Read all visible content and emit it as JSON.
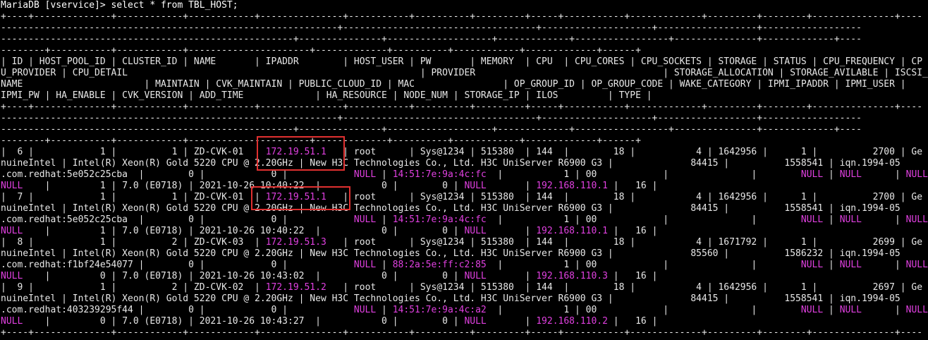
{
  "terminal": {
    "lines": [
      {
        "segs": [
          {
            "t": "MariaDB [vservice]> select * from TBL_HOST;",
            "c": "prompt"
          }
        ]
      },
      {
        "segs": [
          {
            "t": "+----+--------------+------------+------------+---------------+-----------+----------+---------+-----+-----------+-------------+---------+--------+---------------+----"
          }
        ]
      },
      {
        "segs": [
          {
            "t": "-------------------------------------------------------------+-----------------------------------+--------------------+------------------+------------------"
          }
        ]
      },
      {
        "segs": [
          {
            "t": "-----------------------------------------------------+---------------+-------------------+-------------+-----------------+---------------+-------------+----"
          }
        ]
      },
      {
        "segs": [
          {
            "t": "--------+-----------+------------+----------------------+-------------+----------+------------+-------------+------+"
          }
        ]
      },
      {
        "segs": [
          {
            "t": "| ID | HOST_POOL_ID | CLUSTER_ID | NAME       | IPADDR        | HOST_USER | PW       | MEMORY  | CPU  | CPU_CORES | CPU_SOCKETS | STORAGE | STATUS | CPU_FREQUENCY | CP"
          }
        ]
      },
      {
        "segs": [
          {
            "t": "U_PROVIDER | CPU_DETAIL                                                     | PROVIDER                                  | STORAGE_ALLOCATION | STORAGE_AVILABLE | ISCSI_NODE_"
          }
        ]
      },
      {
        "segs": [
          {
            "t": "NAME                      | MAINTAIN | CVK_MAINTAIN | PUBLIC_CLOUD_ID | MAC                | OP_GROUP_ID | OP_GROUP_CODE | WAKE_CATEGORY | IPMI_IPADDR | IPMI_USER |"
          }
        ]
      },
      {
        "segs": [
          {
            "t": "IPMI_PW | HA_ENABLE | CVK_VERSION | ADD_TIME             | HA_RESOURCE | NODE_NUM | STORAGE_IP | ILOS         | TYPE |"
          }
        ]
      },
      {
        "segs": [
          {
            "t": "+----+--------------+------------+------------+---------------+-----------+----------+---------+-----+-----------+-------------+---------+--------+---------------+----"
          }
        ]
      },
      {
        "segs": [
          {
            "t": "-------------------------------------------------------------+-----------------------------------+--------------------+------------------+------------------"
          }
        ]
      },
      {
        "segs": [
          {
            "t": "-----------------------------------------------------+---------------+-------------------+-------------+-----------------+---------------+-------------+----"
          }
        ]
      },
      {
        "segs": [
          {
            "t": "--------+-----------+------------+----------------------+-------------+----------+------------+-------------+------+"
          }
        ]
      },
      {
        "segs": [
          {
            "t": "|  6 |            1 |          1 | ZD-CVK-01  | "
          },
          {
            "t": "172.19.51.1",
            "c": "ip"
          },
          {
            "t": "   | root      | Sys@1234 | 515380  | 144  |        18 |           4 | 1642956 |      1 |          2700 | Ge"
          }
        ]
      },
      {
        "segs": [
          {
            "t": "nuineIntel | Intel(R) Xeon(R) Gold 5220 CPU @ 2.20GHz | New H3C Technologies Co., Ltd. H3C UniServer R6900 G3 |              84415 |          1558541 | iqn.1994-05"
          }
        ]
      },
      {
        "segs": [
          {
            "t": ".com.redhat:5e052c25cba  |        0 |            0 |            "
          },
          {
            "t": "NULL",
            "c": "null"
          },
          {
            "t": " | "
          },
          {
            "t": "14:51:7e:9a:4c:fc",
            "c": "mac"
          },
          {
            "t": "  |           1 | 00            |               |        "
          },
          {
            "t": "NULL",
            "c": "null"
          },
          {
            "t": " | "
          },
          {
            "t": "NULL",
            "c": "null"
          },
          {
            "t": "      | "
          },
          {
            "t": "NULL",
            "c": "null"
          },
          {
            "t": "      |"
          }
        ]
      },
      {
        "segs": [
          {
            "t": "NULL",
            "c": "null"
          },
          {
            "t": "    |         1 | 7.0 (E0718) | 2021-10-26 10:40:22  |           0 |        0 | "
          },
          {
            "t": "NULL",
            "c": "null"
          },
          {
            "t": "       | "
          },
          {
            "t": "192.168.110.1",
            "c": "ip"
          },
          {
            "t": " |   16 |"
          }
        ]
      },
      {
        "segs": [
          {
            "t": "|  7 |            1 |          1 | ZD-CVK-01  | "
          },
          {
            "t": "172.19.51.1",
            "c": "ip"
          },
          {
            "t": "   | root      | Sys@1234 | 515380  | 144  |        18 |           4 | 1642956 |      1 |          2700 | Ge"
          }
        ]
      },
      {
        "segs": [
          {
            "t": "nuineIntel | Intel(R) Xeon(R) Gold 5220 CPU @ 2.20GHz | New H3C Technologies Co., Ltd. H3C UniServer R6900 G3 |              84415 |          1558541 | iqn.1994-05"
          }
        ]
      },
      {
        "segs": [
          {
            "t": ".com.redhat:5e052c25cba  |        0 |            0 |            "
          },
          {
            "t": "NULL",
            "c": "null"
          },
          {
            "t": " | "
          },
          {
            "t": "14:51:7e:9a:4c:fc",
            "c": "mac"
          },
          {
            "t": "  |           1 | 00            |               |        "
          },
          {
            "t": "NULL",
            "c": "null"
          },
          {
            "t": " | "
          },
          {
            "t": "NULL",
            "c": "null"
          },
          {
            "t": "      | "
          },
          {
            "t": "NULL",
            "c": "null"
          },
          {
            "t": "      |"
          }
        ]
      },
      {
        "segs": [
          {
            "t": "NULL",
            "c": "null"
          },
          {
            "t": "    |         1 | 7.0 (E0718) | 2021-10-26 10:40:22  |           0 |        0 | "
          },
          {
            "t": "NULL",
            "c": "null"
          },
          {
            "t": "       | "
          },
          {
            "t": "192.168.110.1",
            "c": "ip"
          },
          {
            "t": " |   16 |"
          }
        ]
      },
      {
        "segs": [
          {
            "t": "|  8 |            1 |          2 | ZD-CVK-03  | "
          },
          {
            "t": "172.19.51.3",
            "c": "ip"
          },
          {
            "t": "   | root      | Sys@1234 | 515380  | 144  |        18 |           4 | 1671792 |      1 |          2699 | Ge"
          }
        ]
      },
      {
        "segs": [
          {
            "t": "nuineIntel | Intel(R) Xeon(R) Gold 5220 CPU @ 2.20GHz | New H3C Technologies Co., Ltd. H3C UniServer R6900 G3 |              85560 |          1586232 | iqn.1994-05"
          }
        ]
      },
      {
        "segs": [
          {
            "t": ".com.redhat:f1bf24e54077 |        0 |            0 |            "
          },
          {
            "t": "NULL",
            "c": "null"
          },
          {
            "t": " | "
          },
          {
            "t": "88:2a:5e:ff:c2:85",
            "c": "mac"
          },
          {
            "t": "  |           1 | 00            |               |        "
          },
          {
            "t": "NULL",
            "c": "null"
          },
          {
            "t": " | "
          },
          {
            "t": "NULL",
            "c": "null"
          },
          {
            "t": "      | "
          },
          {
            "t": "NULL",
            "c": "null"
          },
          {
            "t": "      |"
          }
        ]
      },
      {
        "segs": [
          {
            "t": "NULL",
            "c": "null"
          },
          {
            "t": "    |         0 | 7.0 (E0718) | 2021-10-26 10:43:02  |           0 |        0 | "
          },
          {
            "t": "NULL",
            "c": "null"
          },
          {
            "t": "       | "
          },
          {
            "t": "192.168.110.3",
            "c": "ip"
          },
          {
            "t": " |   16 |"
          }
        ]
      },
      {
        "segs": [
          {
            "t": "|  9 |            1 |          2 | ZD-CVK-02  | "
          },
          {
            "t": "172.19.51.2",
            "c": "ip"
          },
          {
            "t": "   | root      | Sys@1234 | 515380  | 144  |        18 |           4 | 1642956 |      1 |          2697 | Ge"
          }
        ]
      },
      {
        "segs": [
          {
            "t": "nuineIntel | Intel(R) Xeon(R) Gold 5220 CPU @ 2.20GHz | New H3C Technologies Co., Ltd. H3C UniServer R6900 G3 |              84415 |          1558541 | iqn.1994-05"
          }
        ]
      },
      {
        "segs": [
          {
            "t": ".com.redhat:403239295f44 |        0 |            0 |            "
          },
          {
            "t": "NULL",
            "c": "null"
          },
          {
            "t": " | "
          },
          {
            "t": "14:51:7e:9a:4c:a2",
            "c": "mac"
          },
          {
            "t": "  |           1 | 00            |               |        "
          },
          {
            "t": "NULL",
            "c": "null"
          },
          {
            "t": " | "
          },
          {
            "t": "NULL",
            "c": "null"
          },
          {
            "t": "      | "
          },
          {
            "t": "NULL",
            "c": "null"
          },
          {
            "t": "      |"
          }
        ]
      },
      {
        "segs": [
          {
            "t": "NULL",
            "c": "null"
          },
          {
            "t": "    |         0 | 7.0 (E0718) | 2021-10-26 10:43:27  |           0 |        0 | "
          },
          {
            "t": "NULL",
            "c": "null"
          },
          {
            "t": "       | "
          },
          {
            "t": "192.168.110.2",
            "c": "ip"
          },
          {
            "t": " |   16 |"
          }
        ]
      },
      {
        "segs": [
          {
            "t": "+----+--------------+------------+------------+---------------+-----------+----------+---------+-----+-----------+-------------+---------+--------+---------------+----"
          }
        ]
      }
    ]
  },
  "colors": {
    "background": "#000000",
    "text": "#e8e8e8",
    "highlight_value": "#e040e0",
    "annotation_box": "#e03030"
  }
}
